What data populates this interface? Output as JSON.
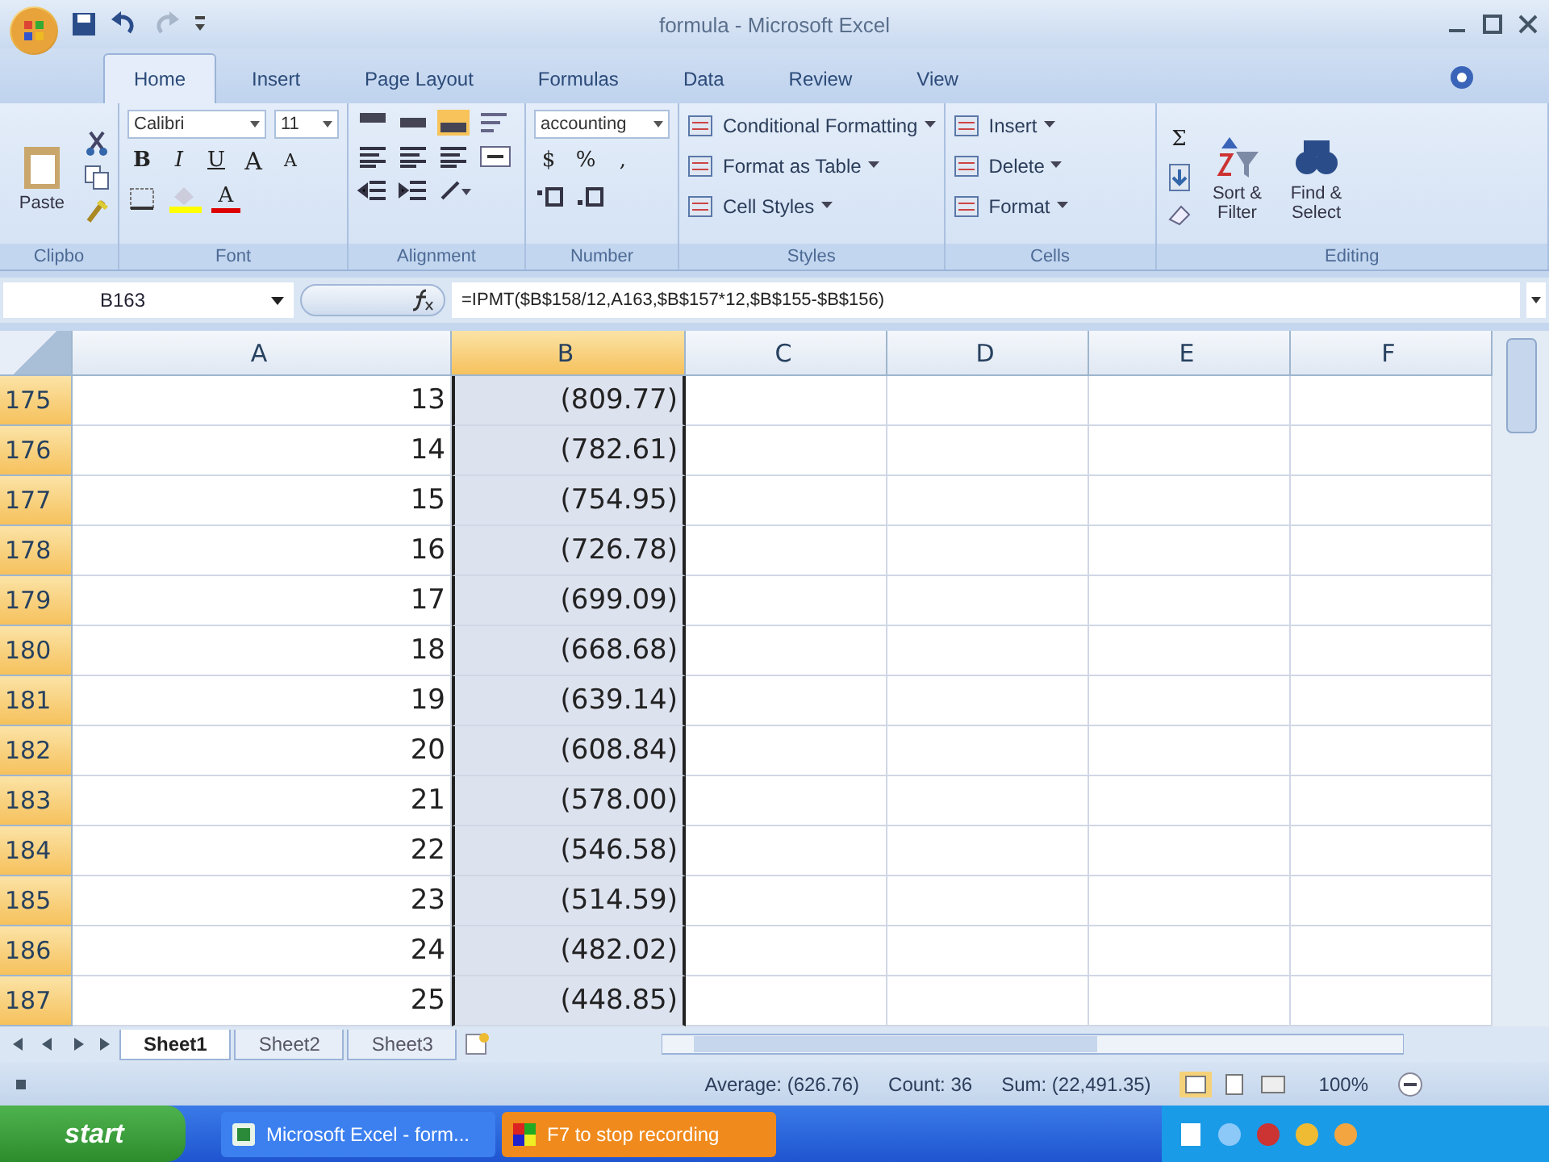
{
  "window": {
    "title": "formula - Microsoft Excel"
  },
  "tabs": [
    {
      "label": "Home",
      "selected": true
    },
    {
      "label": "Insert",
      "selected": false
    },
    {
      "label": "Page Layout",
      "selected": false
    },
    {
      "label": "Formulas",
      "selected": false
    },
    {
      "label": "Data",
      "selected": false
    },
    {
      "label": "Review",
      "selected": false
    },
    {
      "label": "View",
      "selected": false
    }
  ],
  "ribbon": [
    {
      "kind": "clipboard",
      "label": "Clipbo",
      "paste": "Paste"
    },
    {
      "kind": "font",
      "label": "Font",
      "font_name": "Calibri",
      "font_size": "11",
      "style_buttons": [
        "B",
        "I",
        "U"
      ],
      "size_buttons": [
        "A",
        "A"
      ],
      "color_button": "A"
    },
    {
      "kind": "alignment",
      "label": "Alignment"
    },
    {
      "kind": "number",
      "label": "Number",
      "format": "accounting",
      "symbols": [
        "$",
        "%",
        ","
      ]
    },
    {
      "kind": "list",
      "label": "Styles",
      "buttons": [
        "Conditional Formatting",
        "Format as Table",
        "Cell Styles"
      ]
    },
    {
      "kind": "list",
      "label": "Cells",
      "buttons": [
        "Insert",
        "Delete",
        "Format"
      ]
    },
    {
      "kind": "editing",
      "label": "Editing",
      "sum": "Σ",
      "buttons": [
        "Sort & Filter",
        "Find & Select"
      ]
    }
  ],
  "formula_bar": {
    "name_box": "B163",
    "formula": "=IPMT($B$158/12,A163,$B$157*12,$B$155-$B$156)"
  },
  "columns": [
    {
      "label": "A",
      "selected": false
    },
    {
      "label": "B",
      "selected": true
    },
    {
      "label": "C",
      "selected": false
    },
    {
      "label": "D",
      "selected": false
    },
    {
      "label": "E",
      "selected": false
    },
    {
      "label": "F",
      "selected": false
    }
  ],
  "rows": [
    {
      "header": "175",
      "selected": true,
      "cells": [
        "13",
        "(809.77)"
      ]
    },
    {
      "header": "176",
      "selected": true,
      "cells": [
        "14",
        "(782.61)"
      ]
    },
    {
      "header": "177",
      "selected": true,
      "cells": [
        "15",
        "(754.95)"
      ]
    },
    {
      "header": "178",
      "selected": true,
      "cells": [
        "16",
        "(726.78)"
      ]
    },
    {
      "header": "179",
      "selected": true,
      "cells": [
        "17",
        "(699.09)"
      ]
    },
    {
      "header": "180",
      "selected": true,
      "cells": [
        "18",
        "(668.68)"
      ]
    },
    {
      "header": "181",
      "selected": true,
      "cells": [
        "19",
        "(639.14)"
      ]
    },
    {
      "header": "182",
      "selected": true,
      "cells": [
        "20",
        "(608.84)"
      ]
    },
    {
      "header": "183",
      "selected": true,
      "cells": [
        "21",
        "(578.00)"
      ]
    },
    {
      "header": "184",
      "selected": true,
      "cells": [
        "22",
        "(546.58)"
      ]
    },
    {
      "header": "185",
      "selected": true,
      "cells": [
        "23",
        "(514.59)"
      ]
    },
    {
      "header": "186",
      "selected": true,
      "cells": [
        "24",
        "(482.02)"
      ]
    },
    {
      "header": "187",
      "selected": true,
      "cells": [
        "25",
        "(448.85)"
      ]
    }
  ],
  "sheet_tabs": [
    {
      "label": "Sheet1",
      "selected": true
    },
    {
      "label": "Sheet2",
      "selected": false
    },
    {
      "label": "Sheet3",
      "selected": false
    }
  ],
  "status_bar": {
    "average": "Average: (626.76)",
    "count": "Count: 36",
    "sum": "Sum: (22,491.35)",
    "zoom": "100%"
  },
  "taskbar": {
    "start": "start",
    "tasks": [
      {
        "kind": "window",
        "label": "Microsoft Excel - form..."
      },
      {
        "kind": "recorder",
        "label": "F7 to stop recording"
      }
    ]
  }
}
